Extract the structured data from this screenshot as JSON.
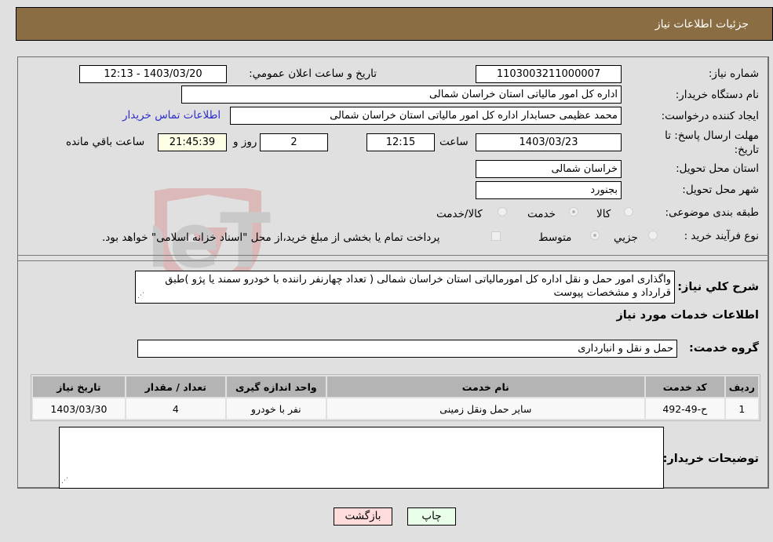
{
  "header": {
    "title": "جزئيات اطلاعات نياز"
  },
  "fields": {
    "need_number": {
      "label": "شماره نياز:",
      "value": "1103003211000007"
    },
    "announce_datetime": {
      "label": "تاريخ و ساعت اعلان عمومي:",
      "value": "1403/03/20 - 12:13"
    },
    "buyer_org": {
      "label": "نام دستگاه خريدار:",
      "value": "اداره کل امور مالياتی استان خراسان شمالی"
    },
    "requester": {
      "label": "ايجاد کننده درخواست:",
      "value": "محمد عظيمی حسابدار اداره کل امور مالياتی استان خراسان شمالی"
    },
    "buyer_contact_link": "اطلاعات تماس خريدار",
    "deadline": {
      "label": "مهلت ارسال پاسخ: تا تاريخ:",
      "date": "1403/03/23",
      "time_label": "ساعت",
      "time": "12:15",
      "days": "2",
      "days_label": "روز و",
      "remaining": "21:45:39",
      "remaining_label": "ساعت باقي مانده"
    },
    "delivery_province": {
      "label": "استان محل تحويل:",
      "value": "خراسان شمالی"
    },
    "delivery_city": {
      "label": "شهر محل تحويل:",
      "value": "بجنورد"
    },
    "category": {
      "label": "طبقه بندی موضوعی:",
      "options": [
        "کالا",
        "خدمت",
        "کالا/خدمت"
      ],
      "selected": "خدمت"
    },
    "purchase_process": {
      "label": "نوع فرآيند خريد :",
      "options": [
        "جزيي",
        "متوسط"
      ],
      "selected": "متوسط",
      "treasury_checkbox_label": "پرداخت تمام يا بخشی از مبلغ خريد،از محل \"اسناد خزانه اسلامی\" خواهد بود.",
      "treasury_checked": false
    }
  },
  "description": {
    "label": "شرح کلي نياز:",
    "value": "واگذاری امور حمل و نقل اداره کل امورمالياتی استان خراسان شمالی  ( تعداد چهارنفر راننده با خودرو سمند يا پژو )طبق قرارداد و مشخصات پيوست"
  },
  "services_section": {
    "title": "اطلاعات خدمات مورد نياز",
    "group_label": "گروه خدمت:",
    "group_value": "حمل و نقل و انبارداری",
    "table": {
      "headers": [
        "رديف",
        "کد خدمت",
        "نام خدمت",
        "واحد اندازه گيری",
        "تعداد / مقدار",
        "تاريخ نياز"
      ],
      "rows": [
        [
          "1",
          "ح-49-492",
          "ساير حمل ونقل زمينی",
          "نفر با خودرو",
          "4",
          "1403/03/30"
        ]
      ]
    }
  },
  "buyer_notes": {
    "label": "توضيحات خريدار:",
    "value": ""
  },
  "buttons": {
    "print": "چاپ",
    "back": "بازگشت"
  },
  "colors": {
    "header_bg": "#8b6d43",
    "print_bg": "#eaffea",
    "back_bg": "#ffdcdc",
    "link": "#2d2dcc"
  }
}
